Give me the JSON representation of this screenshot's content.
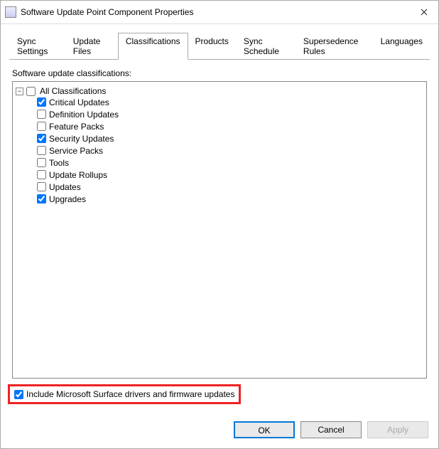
{
  "window": {
    "title": "Software Update Point Component Properties"
  },
  "tabs": [
    {
      "label": "Sync Settings",
      "active": false
    },
    {
      "label": "Update Files",
      "active": false
    },
    {
      "label": "Classifications",
      "active": true
    },
    {
      "label": "Products",
      "active": false
    },
    {
      "label": "Sync Schedule",
      "active": false
    },
    {
      "label": "Supersedence Rules",
      "active": false
    },
    {
      "label": "Languages",
      "active": false
    }
  ],
  "classifications": {
    "label": "Software update classifications:",
    "root_label": "All Classifications",
    "root_checked": false,
    "expanded_glyph": "−",
    "items": [
      {
        "label": "Critical Updates",
        "checked": true
      },
      {
        "label": "Definition Updates",
        "checked": false
      },
      {
        "label": "Feature Packs",
        "checked": false
      },
      {
        "label": "Security Updates",
        "checked": true
      },
      {
        "label": "Service Packs",
        "checked": false
      },
      {
        "label": "Tools",
        "checked": false
      },
      {
        "label": "Update Rollups",
        "checked": false
      },
      {
        "label": "Updates",
        "checked": false
      },
      {
        "label": "Upgrades",
        "checked": true
      }
    ]
  },
  "surface_option": {
    "label": "Include Microsoft Surface drivers and firmware updates",
    "checked": true
  },
  "footer": {
    "ok": "OK",
    "cancel": "Cancel",
    "apply": "Apply"
  }
}
